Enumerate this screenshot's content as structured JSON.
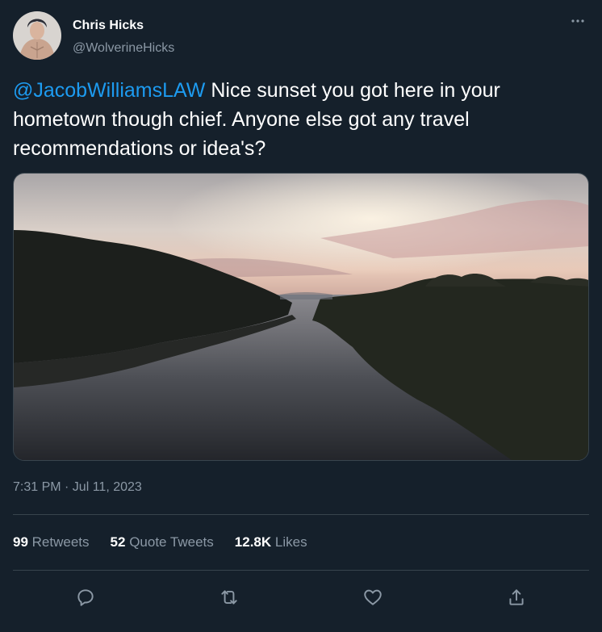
{
  "author": {
    "name": "Chris Hicks",
    "handle": "@WolverineHicks"
  },
  "more_icon": "more-horizontal-icon",
  "tweet": {
    "mention": "@JacobWilliamsLAW",
    "text": " Nice sunset you got here in your hometown though chief. Anyone else got any travel recommendations or idea's?"
  },
  "timestamp": "7:31 PM · Jul 11, 2023",
  "stats": {
    "retweets": {
      "value": "99",
      "label": "Retweets"
    },
    "quotes": {
      "value": "52",
      "label": "Quote Tweets"
    },
    "likes": {
      "value": "12.8K",
      "label": "Likes"
    }
  },
  "actions": [
    "reply-icon",
    "retweet-icon",
    "like-icon",
    "share-icon"
  ],
  "colors": {
    "background": "#15202b",
    "link": "#1d9bf0",
    "secondary_text": "#8b98a5",
    "divider": "#38444d"
  }
}
